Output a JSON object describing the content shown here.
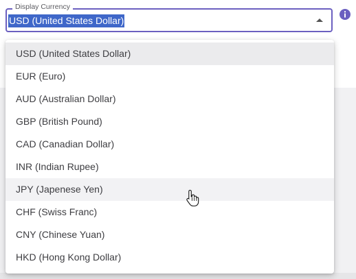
{
  "field": {
    "label": "Display Currency",
    "value": "USD (United States Dollar)"
  },
  "menu": {
    "options": [
      {
        "label": "USD (United States Dollar)",
        "state": "selected"
      },
      {
        "label": "EUR (Euro)",
        "state": "normal"
      },
      {
        "label": "AUD (Australian Dollar)",
        "state": "normal"
      },
      {
        "label": "GBP (British Pound)",
        "state": "normal"
      },
      {
        "label": "CAD (Canadian Dollar)",
        "state": "normal"
      },
      {
        "label": "INR (Indian Rupee)",
        "state": "normal"
      },
      {
        "label": "JPY (Japenese Yen)",
        "state": "hovered"
      },
      {
        "label": "CHF (Swiss Franc)",
        "state": "normal"
      },
      {
        "label": "CNY (Chinese Yuan)",
        "state": "normal"
      },
      {
        "label": "HKD (Hong Kong Dollar)",
        "state": "normal"
      }
    ]
  },
  "colors": {
    "accent": "#6b5fc0",
    "highlight": "#3f67c9",
    "info_icon": "#6b5fc0"
  },
  "icons": {
    "info": "info-icon",
    "caret": "caret-up-icon",
    "cursor": "hand-pointer-icon"
  }
}
